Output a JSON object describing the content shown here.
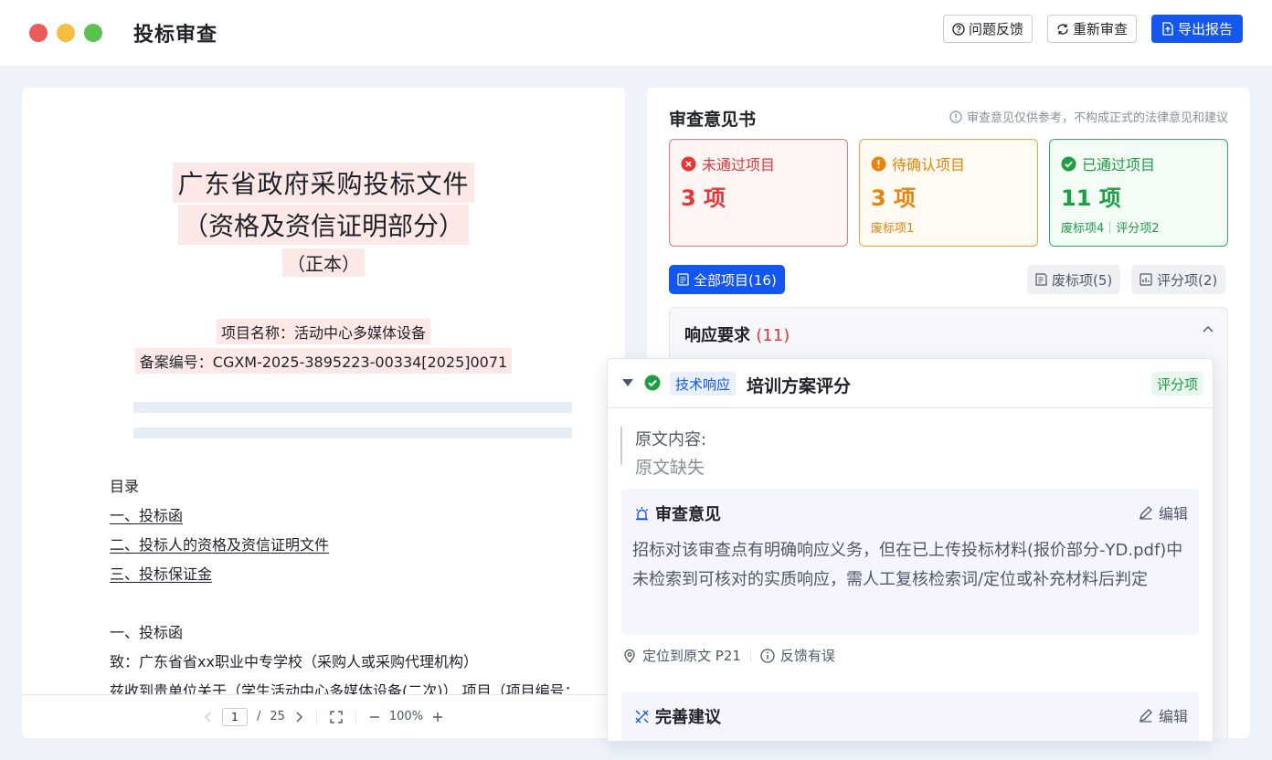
{
  "window": {
    "title": "投标审查",
    "dot_colors": [
      "#ec5b56",
      "#f5bd3f",
      "#5cc14f"
    ]
  },
  "top_actions": {
    "feedback": "问题反馈",
    "recheck": "重新审查",
    "export": "导出报告"
  },
  "document": {
    "title_line1": "广东省政府采购投标文件",
    "title_line2": "（资格及资信证明部分）",
    "title_line3": "（正本）",
    "project_name": "项目名称：活动中心多媒体设备",
    "record_no": "备案编号：CGXM-2025-3895223-00334[2025]0071",
    "toc_heading": "目录",
    "toc_items": [
      "一、投标函",
      "二、投标人的资格及资信证明文件",
      "三、投标保证金"
    ],
    "section_heading": "一、投标函",
    "body_line1": "致：广东省省xx职业中专学校（采购人或采购代理机构）",
    "body_line2": "兹收到贵单位关于（学生活动中心多媒体设备(二次)） 项目（项目编号："
  },
  "pager": {
    "current_page": "1",
    "separator": "/",
    "total_pages": "25",
    "zoom": "100%"
  },
  "review": {
    "title": "审查意见书",
    "disclaimer": "审查意见仅供参考，不构成正式的法律意见和建议",
    "stats": {
      "failed": {
        "label": "未通过项目",
        "count": "3 项"
      },
      "pending": {
        "label": "待确认项目",
        "count": "3 项",
        "sub": "废标项1"
      },
      "passed": {
        "label": "已通过项目",
        "count": "11 项",
        "sub1": "废标项4",
        "sub2": "评分项2"
      }
    },
    "tabs": {
      "all": "全部项目(16)",
      "reject": "废标项(5)",
      "score": "评分项(2)"
    },
    "section": {
      "title": "响应要求",
      "count": "(11)"
    },
    "card": {
      "tag": "技术响应",
      "name": "培训方案评分",
      "type_tag": "评分项",
      "original_label": "原文内容:",
      "original_value": "原文缺失",
      "opinion_title": "审查意见",
      "edit_label": "编辑",
      "opinion_text": "招标对该审查点有明确响应义务，但在已上传投标材料(报价部分-YD.pdf)中未检索到可核对的实质响应，需人工复核检索词/定位或补充材料后判定",
      "locate": "定位到原文 P21",
      "report_error": "反馈有误",
      "suggestion_title": "完善建议",
      "suggestion_edit": "编辑"
    }
  },
  "colors": {
    "primary": "#1456f0",
    "fail": "#e83535",
    "warn": "#e8830c",
    "pass": "#1e9e45",
    "highlight": "#fde8e8"
  }
}
